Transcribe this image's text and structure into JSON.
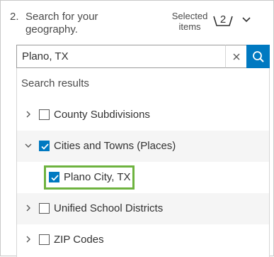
{
  "step": {
    "number": "2.",
    "text": "Search for your geography."
  },
  "selected": {
    "label": "Selected items",
    "count": "2"
  },
  "search": {
    "value": "Plano, TX"
  },
  "results": {
    "title": "Search results",
    "items": [
      {
        "label": "County Subdivisions",
        "expanded": false,
        "checked": false
      },
      {
        "label": "Cities and Towns (Places)",
        "expanded": true,
        "checked": true,
        "children": [
          {
            "label": "Plano City, TX",
            "checked": true
          }
        ]
      },
      {
        "label": "Unified School Districts",
        "expanded": false,
        "checked": false
      },
      {
        "label": "ZIP Codes",
        "expanded": false,
        "checked": false
      }
    ]
  },
  "colors": {
    "accent": "#0079c1",
    "highlight_border": "#6eb33f",
    "row_alt": "#f5f5f5"
  },
  "icons": {
    "basket": "basket-icon",
    "chevron_down": "chevron-down-icon",
    "clear": "close-icon",
    "search": "search-icon"
  }
}
